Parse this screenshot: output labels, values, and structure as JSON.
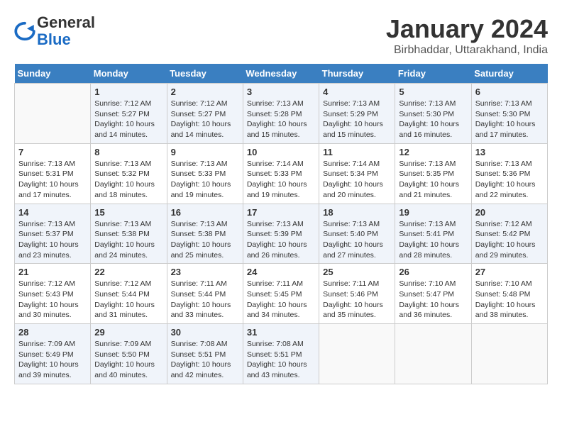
{
  "header": {
    "logo": {
      "general": "General",
      "blue": "Blue"
    },
    "title": "January 2024",
    "subtitle": "Birbhaddar, Uttarakhand, India"
  },
  "calendar": {
    "days_of_week": [
      "Sunday",
      "Monday",
      "Tuesday",
      "Wednesday",
      "Thursday",
      "Friday",
      "Saturday"
    ],
    "weeks": [
      [
        {
          "day": "",
          "info": ""
        },
        {
          "day": "1",
          "info": "Sunrise: 7:12 AM\nSunset: 5:27 PM\nDaylight: 10 hours\nand 14 minutes."
        },
        {
          "day": "2",
          "info": "Sunrise: 7:12 AM\nSunset: 5:27 PM\nDaylight: 10 hours\nand 14 minutes."
        },
        {
          "day": "3",
          "info": "Sunrise: 7:13 AM\nSunset: 5:28 PM\nDaylight: 10 hours\nand 15 minutes."
        },
        {
          "day": "4",
          "info": "Sunrise: 7:13 AM\nSunset: 5:29 PM\nDaylight: 10 hours\nand 15 minutes."
        },
        {
          "day": "5",
          "info": "Sunrise: 7:13 AM\nSunset: 5:30 PM\nDaylight: 10 hours\nand 16 minutes."
        },
        {
          "day": "6",
          "info": "Sunrise: 7:13 AM\nSunset: 5:30 PM\nDaylight: 10 hours\nand 17 minutes."
        }
      ],
      [
        {
          "day": "7",
          "info": "Sunrise: 7:13 AM\nSunset: 5:31 PM\nDaylight: 10 hours\nand 17 minutes."
        },
        {
          "day": "8",
          "info": "Sunrise: 7:13 AM\nSunset: 5:32 PM\nDaylight: 10 hours\nand 18 minutes."
        },
        {
          "day": "9",
          "info": "Sunrise: 7:13 AM\nSunset: 5:33 PM\nDaylight: 10 hours\nand 19 minutes."
        },
        {
          "day": "10",
          "info": "Sunrise: 7:14 AM\nSunset: 5:33 PM\nDaylight: 10 hours\nand 19 minutes."
        },
        {
          "day": "11",
          "info": "Sunrise: 7:14 AM\nSunset: 5:34 PM\nDaylight: 10 hours\nand 20 minutes."
        },
        {
          "day": "12",
          "info": "Sunrise: 7:13 AM\nSunset: 5:35 PM\nDaylight: 10 hours\nand 21 minutes."
        },
        {
          "day": "13",
          "info": "Sunrise: 7:13 AM\nSunset: 5:36 PM\nDaylight: 10 hours\nand 22 minutes."
        }
      ],
      [
        {
          "day": "14",
          "info": "Sunrise: 7:13 AM\nSunset: 5:37 PM\nDaylight: 10 hours\nand 23 minutes."
        },
        {
          "day": "15",
          "info": "Sunrise: 7:13 AM\nSunset: 5:38 PM\nDaylight: 10 hours\nand 24 minutes."
        },
        {
          "day": "16",
          "info": "Sunrise: 7:13 AM\nSunset: 5:38 PM\nDaylight: 10 hours\nand 25 minutes."
        },
        {
          "day": "17",
          "info": "Sunrise: 7:13 AM\nSunset: 5:39 PM\nDaylight: 10 hours\nand 26 minutes."
        },
        {
          "day": "18",
          "info": "Sunrise: 7:13 AM\nSunset: 5:40 PM\nDaylight: 10 hours\nand 27 minutes."
        },
        {
          "day": "19",
          "info": "Sunrise: 7:13 AM\nSunset: 5:41 PM\nDaylight: 10 hours\nand 28 minutes."
        },
        {
          "day": "20",
          "info": "Sunrise: 7:12 AM\nSunset: 5:42 PM\nDaylight: 10 hours\nand 29 minutes."
        }
      ],
      [
        {
          "day": "21",
          "info": "Sunrise: 7:12 AM\nSunset: 5:43 PM\nDaylight: 10 hours\nand 30 minutes."
        },
        {
          "day": "22",
          "info": "Sunrise: 7:12 AM\nSunset: 5:44 PM\nDaylight: 10 hours\nand 31 minutes."
        },
        {
          "day": "23",
          "info": "Sunrise: 7:11 AM\nSunset: 5:44 PM\nDaylight: 10 hours\nand 33 minutes."
        },
        {
          "day": "24",
          "info": "Sunrise: 7:11 AM\nSunset: 5:45 PM\nDaylight: 10 hours\nand 34 minutes."
        },
        {
          "day": "25",
          "info": "Sunrise: 7:11 AM\nSunset: 5:46 PM\nDaylight: 10 hours\nand 35 minutes."
        },
        {
          "day": "26",
          "info": "Sunrise: 7:10 AM\nSunset: 5:47 PM\nDaylight: 10 hours\nand 36 minutes."
        },
        {
          "day": "27",
          "info": "Sunrise: 7:10 AM\nSunset: 5:48 PM\nDaylight: 10 hours\nand 38 minutes."
        }
      ],
      [
        {
          "day": "28",
          "info": "Sunrise: 7:09 AM\nSunset: 5:49 PM\nDaylight: 10 hours\nand 39 minutes."
        },
        {
          "day": "29",
          "info": "Sunrise: 7:09 AM\nSunset: 5:50 PM\nDaylight: 10 hours\nand 40 minutes."
        },
        {
          "day": "30",
          "info": "Sunrise: 7:08 AM\nSunset: 5:51 PM\nDaylight: 10 hours\nand 42 minutes."
        },
        {
          "day": "31",
          "info": "Sunrise: 7:08 AM\nSunset: 5:51 PM\nDaylight: 10 hours\nand 43 minutes."
        },
        {
          "day": "",
          "info": ""
        },
        {
          "day": "",
          "info": ""
        },
        {
          "day": "",
          "info": ""
        }
      ]
    ]
  }
}
